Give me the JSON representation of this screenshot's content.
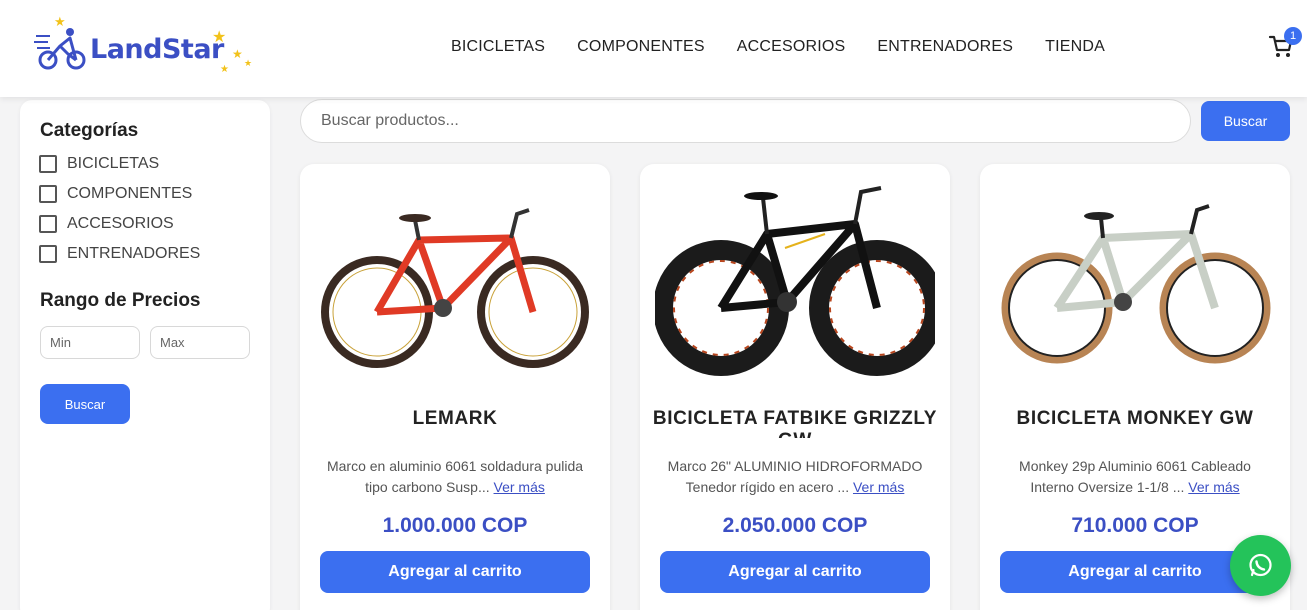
{
  "brand": {
    "name": "LandStar",
    "accent": "#3b6ff0",
    "brand_color": "#3b4fc4"
  },
  "nav": [
    "BICICLETAS",
    "COMPONENTES",
    "ACCESORIOS",
    "ENTRENADORES",
    "TIENDA"
  ],
  "cart": {
    "icon": "cart-icon",
    "count": "1"
  },
  "sidebar": {
    "categories_title": "Categorías",
    "categories": [
      "BICICLETAS",
      "COMPONENTES",
      "ACCESORIOS",
      "ENTRENADORES"
    ],
    "price_title": "Rango de Precios",
    "min_placeholder": "Min",
    "max_placeholder": "Max",
    "search_label": "Buscar"
  },
  "search": {
    "placeholder": "Buscar productos...",
    "button": "Buscar"
  },
  "products": [
    {
      "name": "LEMARK",
      "desc": "Marco en aluminio 6061 soldadura pulida tipo carbono Susp...",
      "more": "Ver más",
      "price": "1.000.000 COP",
      "button": "Agregar al carrito"
    },
    {
      "name": "BICICLETA FATBIKE GRIZZLY GW",
      "desc": "Marco 26\" ALUMINIO HIDROFORMADO Tenedor rígido en acero ...",
      "more": "Ver más",
      "price": "2.050.000 COP",
      "button": "Agregar al carrito"
    },
    {
      "name": "BICICLETA MONKEY GW",
      "desc": "Monkey 29p Aluminio 6061 Cableado Interno Oversize 1-1/8 ...",
      "more": "Ver más",
      "price": "710.000 COP",
      "button": "Agregar al carrito"
    }
  ],
  "whatsapp": {
    "icon": "whatsapp-icon",
    "color": "#24c35a"
  }
}
